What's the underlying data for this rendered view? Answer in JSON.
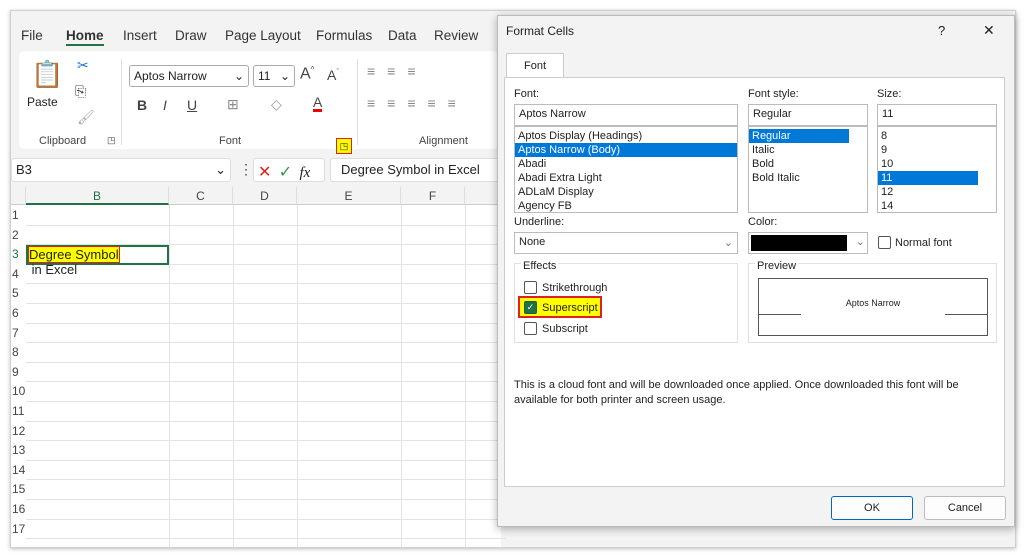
{
  "ribbon": {
    "tabs": [
      "File",
      "Home",
      "Insert",
      "Draw",
      "Page Layout",
      "Formulas",
      "Data",
      "Review"
    ],
    "paste": "Paste",
    "font_name": "Aptos Narrow",
    "font_size": "11",
    "groups": {
      "clipboard": "Clipboard",
      "font": "Font",
      "alignment": "Alignment"
    }
  },
  "formula_bar": {
    "name_box": "B3",
    "content": "Degree Symbol in Excel"
  },
  "sheet": {
    "columns": [
      "B",
      "C",
      "D",
      "E",
      "F"
    ],
    "rows": [
      "1",
      "2",
      "3",
      "4",
      "5",
      "6",
      "7",
      "8",
      "9",
      "10",
      "11",
      "12",
      "13",
      "14",
      "15",
      "16",
      "17"
    ],
    "b3_highlight": "Degree Symbol",
    "b3_rest": " in Excel"
  },
  "dialog": {
    "title": "Format Cells",
    "help": "?",
    "close": "✕",
    "tab": "Font",
    "font_label": "Font:",
    "font_value": "Aptos Narrow",
    "fonts": [
      "Aptos Display (Headings)",
      "Aptos Narrow (Body)",
      "Abadi",
      "Abadi Extra Light",
      "ADLaM Display",
      "Agency FB"
    ],
    "style_label": "Font style:",
    "style_value": "Regular",
    "styles": [
      "Regular",
      "Italic",
      "Bold",
      "Bold Italic"
    ],
    "size_label": "Size:",
    "size_value": "11",
    "sizes": [
      "8",
      "9",
      "10",
      "11",
      "12",
      "14"
    ],
    "underline_label": "Underline:",
    "underline_value": "None",
    "color_label": "Color:",
    "color_value": "#000000",
    "normal_font": "Normal font",
    "effects_label": "Effects",
    "strikethrough": "Strikethrough",
    "superscript": "Superscript",
    "subscript": "Subscript",
    "superscript_checked": true,
    "preview_label": "Preview",
    "preview_text": "Aptos Narrow",
    "note": "This is a cloud font and will be downloaded once applied. Once downloaded this font will be available for both printer and screen usage.",
    "ok": "OK",
    "cancel": "Cancel"
  },
  "colors": {
    "accent": "#0078d7",
    "excel_green": "#217346",
    "highlight": "#ffff00",
    "annotation": "#e02020"
  }
}
